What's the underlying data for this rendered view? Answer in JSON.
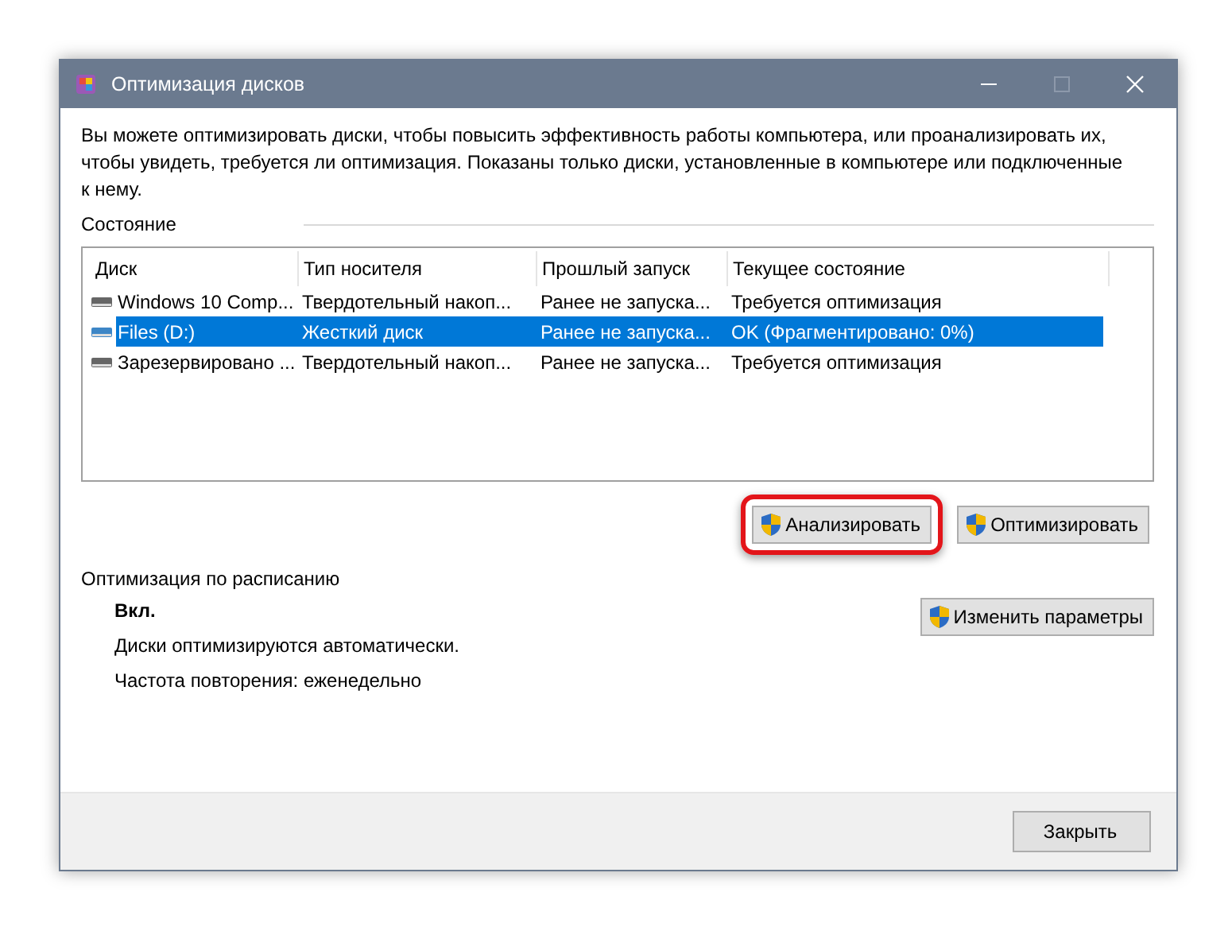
{
  "window": {
    "title": "Оптимизация дисков"
  },
  "description": "Вы можете оптимизировать диски, чтобы повысить эффективность работы  компьютера, или проанализировать их, чтобы увидеть, требуется ли оптимизация. Показаны только диски, установленные в компьютере или подключенные к нему.",
  "status_section": {
    "label": "Состояние"
  },
  "table": {
    "columns": [
      "Диск",
      "Тип носителя",
      "Прошлый запуск",
      "Текущее состояние"
    ],
    "rows": [
      {
        "cells": [
          "Windows 10 Comp...",
          "Твердотельный накоп...",
          "Ранее не запуска...",
          "Требуется оптимизация"
        ],
        "selected": false
      },
      {
        "cells": [
          "Files (D:)",
          "Жесткий диск",
          "Ранее не запуска...",
          "OK (Фрагментировано: 0%)"
        ],
        "selected": true
      },
      {
        "cells": [
          "Зарезервировано ...",
          "Твердотельный накоп...",
          "Ранее не запуска...",
          "Требуется оптимизация"
        ],
        "selected": false
      }
    ]
  },
  "actions": [
    {
      "label": "Анализировать",
      "highlighted": true
    },
    {
      "label": "Оптимизировать",
      "highlighted": false
    }
  ],
  "schedule": {
    "label": "Оптимизация по расписанию",
    "state": "Вкл.",
    "lines": [
      "Диски оптимизируются автоматически.",
      "Частота повторения: еженедельно"
    ],
    "button": "Изменить параметры"
  },
  "footer": {
    "close_button": "Закрыть"
  }
}
